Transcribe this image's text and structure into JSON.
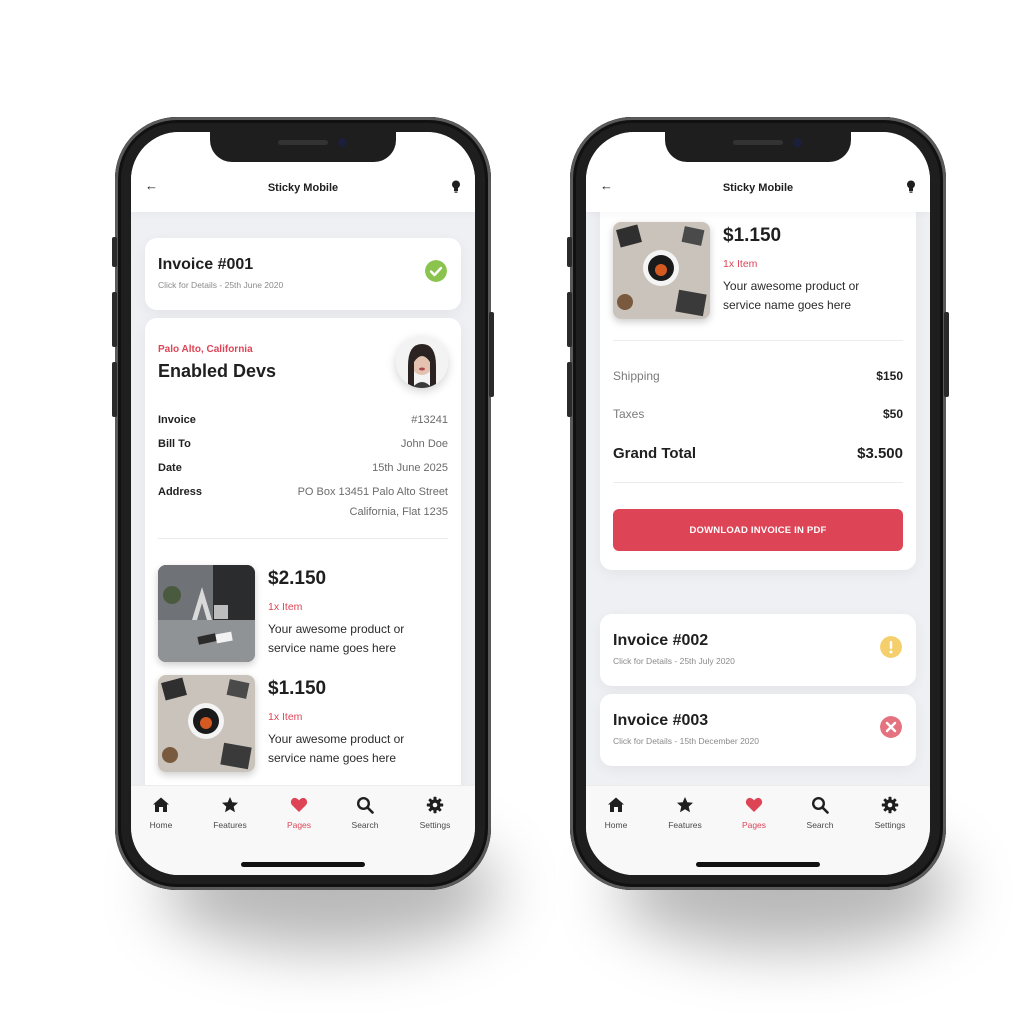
{
  "colors": {
    "accent": "#dd4557",
    "success": "#8ac44f",
    "warning": "#f5cf6b",
    "danger": "#e5737f",
    "text": "#1f1f1f",
    "muted": "#8a8a8a"
  },
  "app": {
    "title": "Sticky Mobile",
    "back_icon": "arrow-left-icon",
    "right_icon": "lightbulb-icon"
  },
  "left_screen": {
    "invoice_card": {
      "title": "Invoice #001",
      "subtitle": "Click for Details - 25th June 2020",
      "status_icon": "check-circle-icon"
    },
    "detail_card": {
      "location": "Palo Alto, California",
      "company": "Enabled Devs",
      "rows": [
        {
          "label": "Invoice",
          "value": "#13241"
        },
        {
          "label": "Bill To",
          "value": "John Doe"
        },
        {
          "label": "Date",
          "value": "15th June 2025"
        },
        {
          "label": "Address",
          "value_line1": "PO Box 13451 Palo Alto Street",
          "value_line2": "California, Flat 1235"
        }
      ],
      "products": [
        {
          "price": "$2.150",
          "qty": "1x Item",
          "desc": "Your awesome product or service name goes here"
        },
        {
          "price": "$1.150",
          "qty": "1x Item",
          "desc": "Your awesome product or service name goes here"
        }
      ]
    }
  },
  "right_screen": {
    "product": {
      "price": "$1.150",
      "qty": "1x Item",
      "desc": "Your awesome product or service name goes here"
    },
    "summary": [
      {
        "label": "Shipping",
        "value": "$150"
      },
      {
        "label": "Taxes",
        "value": "$50"
      }
    ],
    "grand_total": {
      "label": "Grand Total",
      "value": "$3.500"
    },
    "download_label": "DOWNLOAD INVOICE IN PDF",
    "invoices": [
      {
        "title": "Invoice #002",
        "subtitle": "Click for Details - 25th July 2020",
        "status_icon": "exclamation-circle-icon"
      },
      {
        "title": "Invoice #003",
        "subtitle": "Click for Details - 15th December 2020",
        "status_icon": "times-circle-icon"
      }
    ]
  },
  "tabbar": {
    "items": [
      {
        "label": "Home",
        "icon": "home-icon"
      },
      {
        "label": "Features",
        "icon": "star-icon"
      },
      {
        "label": "Pages",
        "icon": "heart-icon",
        "active": true
      },
      {
        "label": "Search",
        "icon": "search-icon"
      },
      {
        "label": "Settings",
        "icon": "gear-icon"
      }
    ]
  }
}
